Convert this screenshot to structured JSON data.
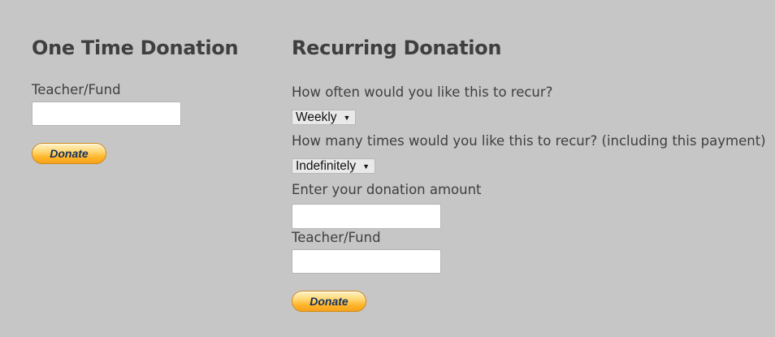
{
  "one_time": {
    "heading": "One Time Donation",
    "fund_label": "Teacher/Fund",
    "fund_value": "",
    "donate_label": "Donate"
  },
  "recurring": {
    "heading": "Recurring Donation",
    "frequency_question": "How often would you like this to recur?",
    "frequency_selected": "Weekly",
    "count_question": "How many times would you like this to recur? (including this payment)",
    "count_selected": "Indefinitely",
    "amount_label": "Enter your donation amount",
    "amount_value": "",
    "fund_label": "Teacher/Fund",
    "fund_value": "",
    "donate_label": "Donate"
  }
}
